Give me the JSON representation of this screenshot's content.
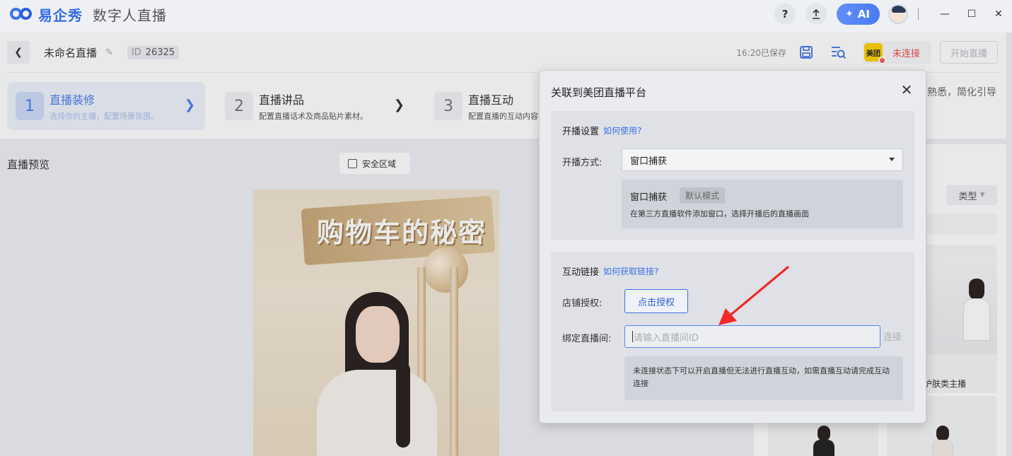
{
  "app": {
    "logo_text": "易企秀",
    "product_name": "数字人直播",
    "help_label": "?",
    "ai_label": "AI"
  },
  "header": {
    "title": "未命名直播",
    "id_key": "ID",
    "id_value": "26325",
    "saved_text": "16:20已保存",
    "platform_logo": "美团",
    "platform_status": "未连接",
    "start_label": "开始直播",
    "right_hint": "熟悉，简化引导"
  },
  "steps": [
    {
      "num": "1",
      "title": "直播装修",
      "desc": "选择你的主播，配置场景氛围。",
      "active": true
    },
    {
      "num": "2",
      "title": "直播讲品",
      "desc": "配置直播话术及商品贴片素材。",
      "active": false
    },
    {
      "num": "3",
      "title": "直播互动",
      "desc": "配置直播的互动内容",
      "active": false
    }
  ],
  "preview": {
    "label": "直播预览",
    "safe_area_label": "安全区域",
    "poster_title": "购物车的秘密"
  },
  "right_panel": {
    "type_label": "类型",
    "card_label": "护肤类主播"
  },
  "dialog": {
    "title": "关联到美团直播平台",
    "section1": {
      "heading": "开播设置",
      "help_link": "如何使用?",
      "mode_label": "开播方式:",
      "mode_value": "窗口捕获",
      "mode_name": "窗口捕获",
      "mode_tag": "默认模式",
      "mode_desc": "在第三方直播软件添加窗口，选择开播后的直播画面"
    },
    "section2": {
      "heading": "互动链接",
      "help_link": "如何获取链接?",
      "auth_label": "店铺授权:",
      "auth_button": "点击授权",
      "bind_label": "绑定直播间:",
      "bind_placeholder": "请输入直播间ID",
      "connect_label": "连接",
      "note": "未连接状态下可以开启直播但无法进行直播互动，如需直播互动请完成互动连接"
    }
  },
  "colors": {
    "accent": "#4a7bf0",
    "danger": "#f04b4b",
    "annotation": "#f02a2a"
  }
}
